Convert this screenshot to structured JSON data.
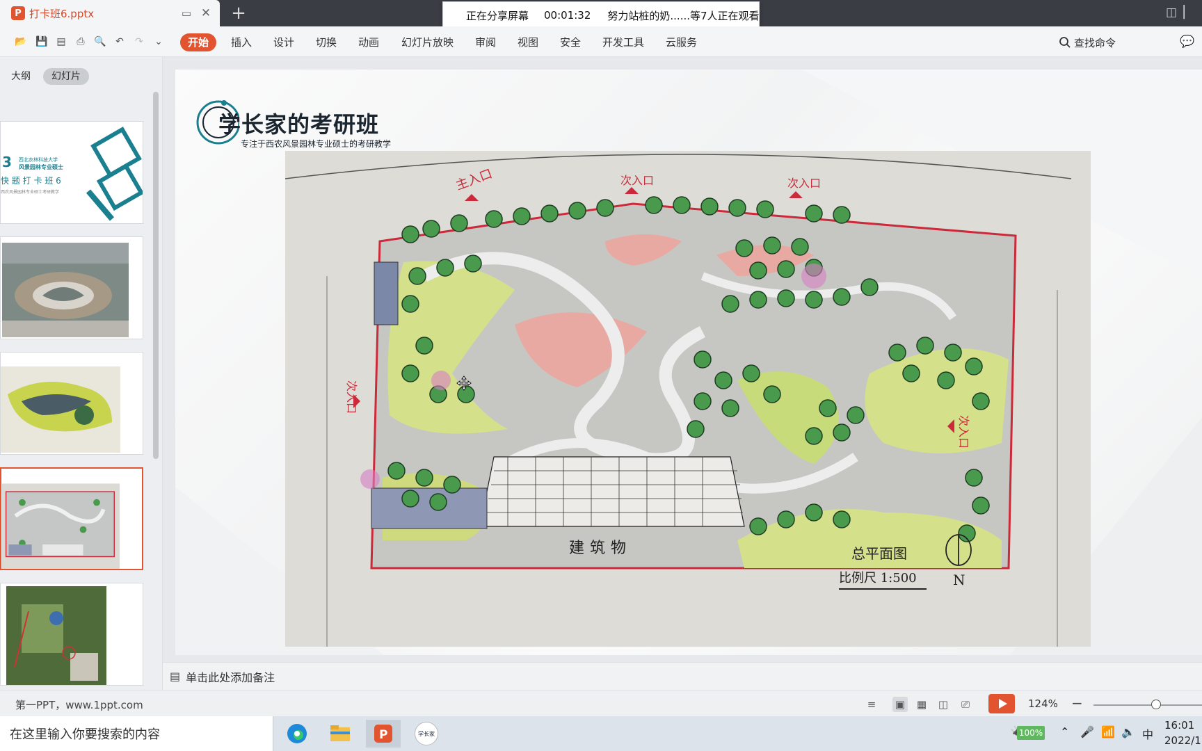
{
  "titlebar": {
    "doc_title": "打卡班6.pptx",
    "new_tab": "+",
    "share": {
      "status": "正在分享屏幕",
      "duration": "00:01:32",
      "viewers": "努力站桩的奶......等7人正在观看"
    }
  },
  "ribbon": {
    "menu": [
      "开始",
      "插入",
      "设计",
      "切换",
      "动画",
      "幻灯片放映",
      "审阅",
      "视图",
      "安全",
      "开发工具",
      "云服务"
    ],
    "search_label": "查找命令"
  },
  "left_panel": {
    "tab_outline": "大纲",
    "tab_slides": "幻灯片",
    "thumb1": {
      "year": "3",
      "university": "西北农林科技大学",
      "major": "风景园林专业硕士",
      "title": "快 题 打 卡 班 6",
      "footnote": "西农风景园林专业硕士考研教学"
    }
  },
  "slide": {
    "logo_title": "学长家的考研班",
    "logo_subtitle": "专注于西农风景园林专业硕士的考研教学",
    "drawing": {
      "entrances": [
        "主入口",
        "次入口",
        "次入口",
        "次入口",
        "次入口"
      ],
      "building": "建筑物",
      "plan_title": "总平面图",
      "scale": "比例尺 1:500",
      "north": "N"
    }
  },
  "notes": {
    "placeholder": "单击此处添加备注"
  },
  "statusbar": {
    "left_text": "第一PPT，www.1ppt.com",
    "zoom": "124%"
  },
  "taskbar": {
    "search_placeholder": "在这里输入你要搜索的内容",
    "zoom_app_label": "学长家",
    "battery": "100%",
    "ime": "中",
    "time": "16:01",
    "date": "2022/1"
  },
  "colors": {
    "accent": "#e2542f",
    "teal": "#1a7f8e",
    "grass": "#c9d96a",
    "tree": "#4a9a4e",
    "pink": "#e88a8a",
    "border_red": "#cc2a3a"
  }
}
